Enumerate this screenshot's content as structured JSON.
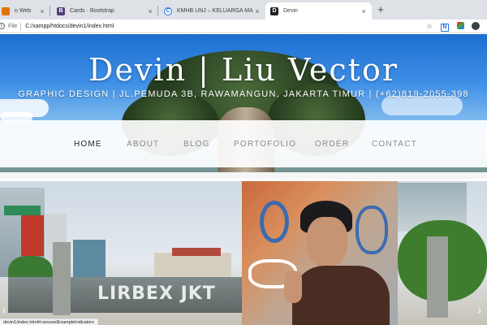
{
  "browser": {
    "tabs": [
      {
        "title": "o Web",
        "favicon": "globe-icon",
        "favicon_color": "#e37400",
        "active": false
      },
      {
        "title": "Cards · Bootstrap",
        "favicon": "bootstrap-icon",
        "favicon_color": "#563d7c",
        "active": false
      },
      {
        "title": "KMHB UNJ – KELUARGA MAHAS",
        "favicon": "kmhb-icon",
        "favicon_color": "#1a73e8",
        "active": false
      },
      {
        "title": "Devin",
        "favicon": "devin-icon",
        "favicon_color": "#202124",
        "active": true
      }
    ],
    "new_tab_glyph": "+",
    "close_glyph": "×",
    "address": {
      "label": "File",
      "url": "C:/xampp/htdocs/devin1/index.html"
    }
  },
  "site": {
    "title": "Devin | Liu Vector",
    "subtitle": "GRAPHIC DESIGN | JL.PEMUDA 3B, RAWAMANGUN, JAKARTA TIMUR | (+62)819-2055-398",
    "nav": [
      {
        "label": "HOME",
        "active": true
      },
      {
        "label": "ABOUT",
        "active": false
      },
      {
        "label": "BLOG",
        "active": false
      },
      {
        "label": "PORTOFOLIO",
        "active": false
      },
      {
        "label": "ORDER",
        "active": false
      },
      {
        "label": "CONTACT",
        "active": false
      }
    ],
    "carousel": {
      "graffiti_text": "LIRBEX JKT",
      "prev_glyph": "‹",
      "next_glyph": "›"
    }
  },
  "status_bar": {
    "text": "devin1/index.html#carouselExampleIndicators"
  },
  "colors": {
    "accent_blue": "#1a73e8",
    "nav_active": "#222222",
    "nav_inactive": "#8a8a8a"
  }
}
